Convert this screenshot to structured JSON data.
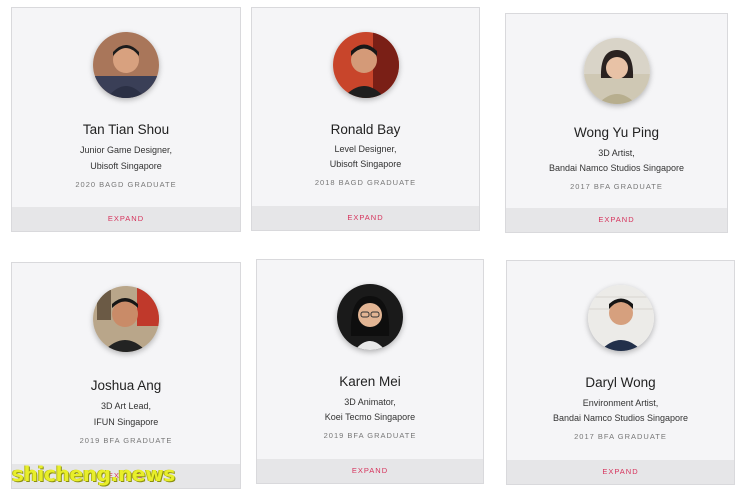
{
  "colors": {
    "card_bg": "#f5f5f7",
    "expand_bar": "#e6e6e8",
    "expand_text": "#d6335c",
    "watermark": "#e8ee2a"
  },
  "profiles": [
    {
      "name": "Tan Tian Shou",
      "role": "Junior Game Designer,",
      "company": "Ubisoft Singapore",
      "graduate": "2020 BAGD GRADUATE",
      "expand": "EXPAND"
    },
    {
      "name": "Ronald Bay",
      "role": "Level Designer,",
      "company": "Ubisoft Singapore",
      "graduate": "2018 BAGD GRADUATE",
      "expand": "EXPAND"
    },
    {
      "name": "Wong Yu Ping",
      "role": "3D Artist,",
      "company": "Bandai Namco Studios Singapore",
      "graduate": "2017 BFA GRADUATE",
      "expand": "EXPAND"
    },
    {
      "name": "Joshua Ang",
      "role": "3D Art Lead,",
      "company": "IFUN Singapore",
      "graduate": "2019 BFA GRADUATE",
      "expand": "EXPAND"
    },
    {
      "name": "Karen Mei",
      "role": "3D Animator,",
      "company": "Koei Tecmo Singapore",
      "graduate": "2019 BFA GRADUATE",
      "expand": "EXPAND"
    },
    {
      "name": "Daryl Wong",
      "role": "Environment Artist,",
      "company": "Bandai Namco Studios Singapore",
      "graduate": "2017 BFA GRADUATE",
      "expand": "EXPAND"
    }
  ],
  "watermark": "shicheng.news"
}
